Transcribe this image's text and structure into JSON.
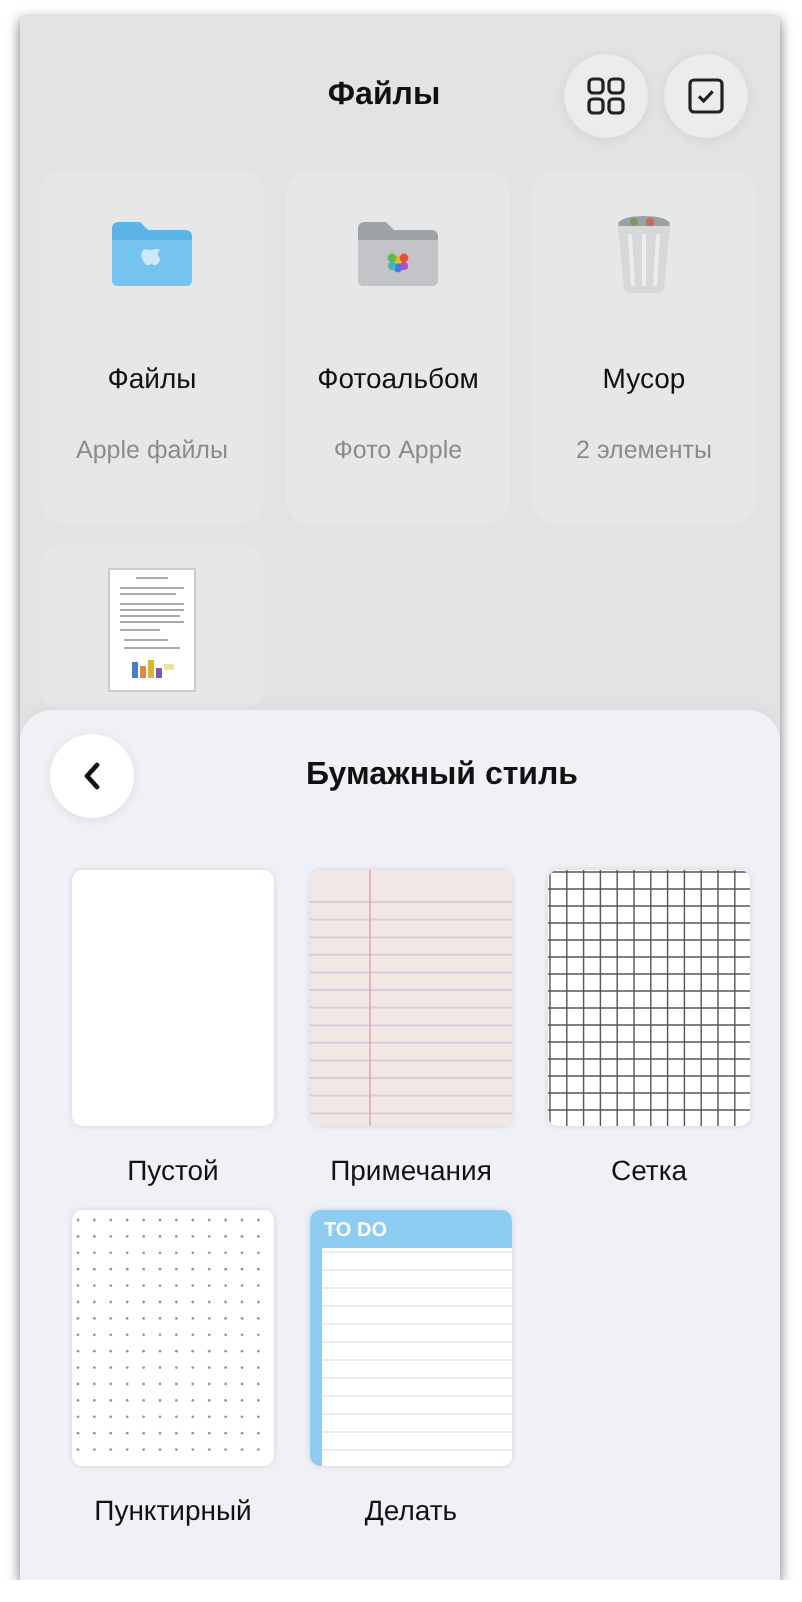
{
  "header": {
    "title": "Файлы"
  },
  "folders": [
    {
      "kind": "folder",
      "name": "Файлы",
      "subtitle": "Apple файлы"
    },
    {
      "kind": "photos",
      "name": "Фотоальбом",
      "subtitle": "Фото Apple"
    },
    {
      "kind": "trash",
      "name": "Мусор",
      "subtitle": "2 элементы"
    },
    {
      "kind": "document"
    }
  ],
  "sheet": {
    "title": "Бумажный стиль",
    "papers": [
      {
        "kind": "blank",
        "label": "Пустой"
      },
      {
        "kind": "lined",
        "label": "Примечания"
      },
      {
        "kind": "grid",
        "label": "Сетка"
      },
      {
        "kind": "dotted",
        "label": "Пунктирный"
      },
      {
        "kind": "todo",
        "label": "Делать",
        "header": "TO DO"
      }
    ]
  }
}
